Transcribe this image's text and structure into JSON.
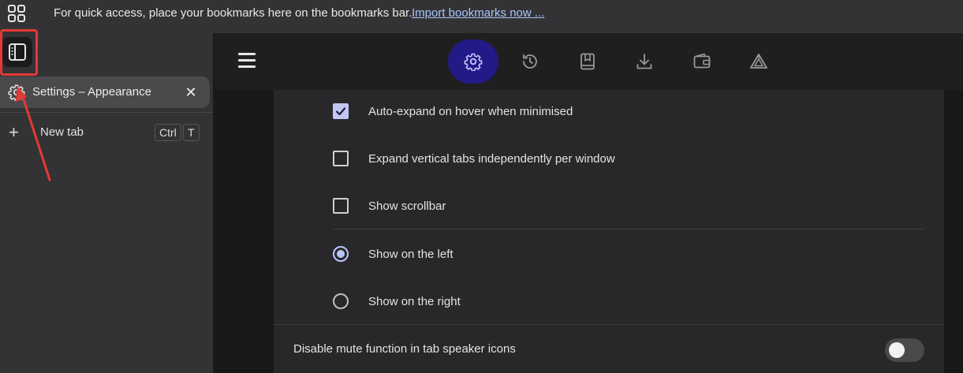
{
  "bookmarks_bar": {
    "message": "For quick access, place your bookmarks here on the bookmarks bar.",
    "import_link": "Import bookmarks now ..."
  },
  "sidebar": {
    "active_tab": {
      "label": "Settings – Appearance",
      "close": "✕",
      "icon": "gear-icon"
    },
    "new_tab": {
      "label": "New tab",
      "shortcut_ctrl": "Ctrl",
      "shortcut_key": "T",
      "icon": "plus-icon"
    }
  },
  "toolbar": {
    "icons": [
      "menu-icon",
      "settings-icon",
      "history-icon",
      "bookmarks-icon",
      "downloads-icon",
      "wallet-icon",
      "leo-icon"
    ],
    "active": "settings-icon"
  },
  "settings": {
    "options": [
      {
        "label": "Auto-expand on hover when minimised",
        "type": "checkbox",
        "checked": true
      },
      {
        "label": "Expand vertical tabs independently per window",
        "type": "checkbox",
        "checked": false
      },
      {
        "label": "Show scrollbar",
        "type": "checkbox",
        "checked": false
      },
      {
        "label": "Show on the left",
        "type": "radio",
        "checked": true
      },
      {
        "label": "Show on the right",
        "type": "radio",
        "checked": false
      }
    ],
    "mute_toggle": {
      "label": "Disable mute function in tab speaker icons",
      "enabled": false
    }
  },
  "colors": {
    "accent": "#221a86",
    "checkbox_checked": "#c2c6f5",
    "radio_selected": "#b8c6ff",
    "link": "#a8c4ff",
    "annotation_red": "#e53935"
  }
}
